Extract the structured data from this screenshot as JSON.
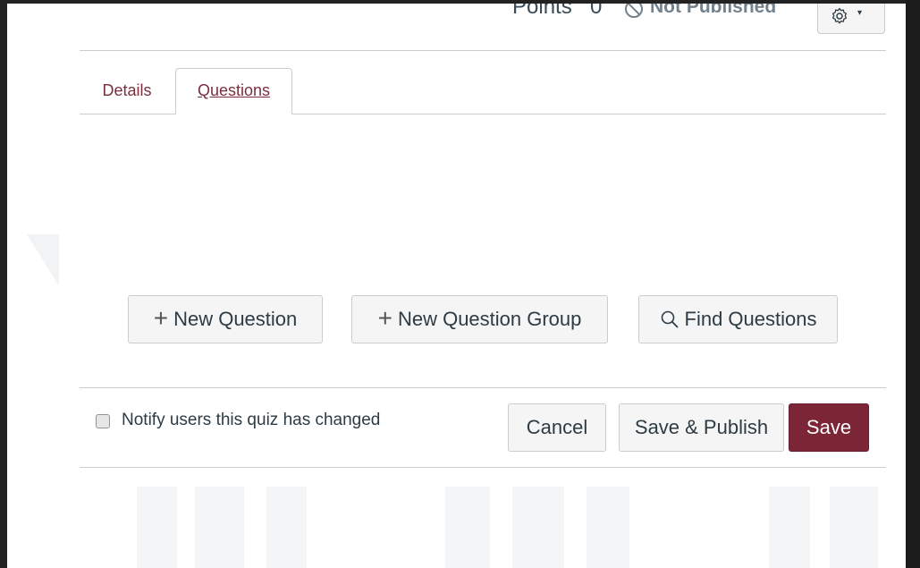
{
  "header": {
    "points_label": "Points",
    "points_value": "0",
    "publish_status": "Not Published",
    "settings_icon": "gear-icon",
    "settings_caret": "▾"
  },
  "tabs": [
    {
      "label": "Details",
      "active": false
    },
    {
      "label": "Questions",
      "active": true
    }
  ],
  "actions": {
    "new_question": "New Question",
    "new_question_group": "New Question Group",
    "find_questions": "Find Questions"
  },
  "footer": {
    "notify_label": "Notify users this quiz has changed",
    "notify_checked": false,
    "cancel": "Cancel",
    "save_publish": "Save & Publish",
    "save": "Save"
  },
  "colors": {
    "accent": "#7b2536",
    "tab_text": "#7a2f3d",
    "border": "#c7cdd1",
    "button_bg": "#f5f5f5"
  }
}
